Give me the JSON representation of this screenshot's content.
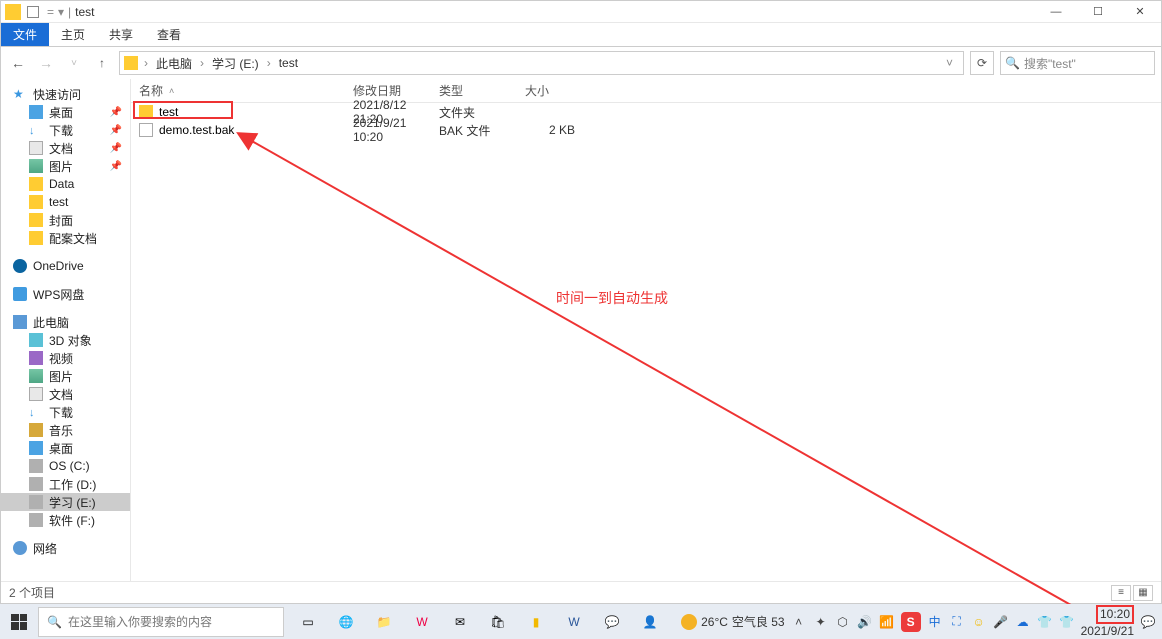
{
  "title": "test",
  "breadcrumb": {
    "pc": "此电脑",
    "drive": "学习 (E:)",
    "folder": "test"
  },
  "ribbon": {
    "file": "文件",
    "home": "主页",
    "share": "共享",
    "view": "查看"
  },
  "search_placeholder": "搜索\"test\"",
  "sidebar": {
    "quick": "快速访问",
    "desktop": "桌面",
    "downloads": "下载",
    "documents": "文档",
    "pictures": "图片",
    "data": "Data",
    "test": "test",
    "cover": "封面",
    "cfg": "配案文档",
    "onedrive": "OneDrive",
    "wps": "WPS网盘",
    "thispc": "此电脑",
    "obj3d": "3D 对象",
    "video": "视频",
    "pic2": "图片",
    "doc2": "文档",
    "dl2": "下载",
    "music": "音乐",
    "desk2": "桌面",
    "osc": "OS (C:)",
    "workd": "工作 (D:)",
    "studye": "学习 (E:)",
    "softf": "软件 (F:)",
    "network": "网络"
  },
  "cols": {
    "name": "名称",
    "date": "修改日期",
    "type": "类型",
    "size": "大小"
  },
  "rows": [
    {
      "name": "test",
      "date": "2021/8/12 21:20",
      "type": "文件夹",
      "size": ""
    },
    {
      "name": "demo.test.bak",
      "date": "2021/9/21 10:20",
      "type": "BAK 文件",
      "size": "2 KB"
    }
  ],
  "annotation": "时间一到自动生成",
  "status": "2 个项目",
  "taskbar": {
    "search": "在这里输入你要搜索的内容",
    "weather_temp": "26°C",
    "weather_txt": "空气良 53",
    "ime": "中",
    "time": "10:20",
    "date": "2021/9/21"
  }
}
